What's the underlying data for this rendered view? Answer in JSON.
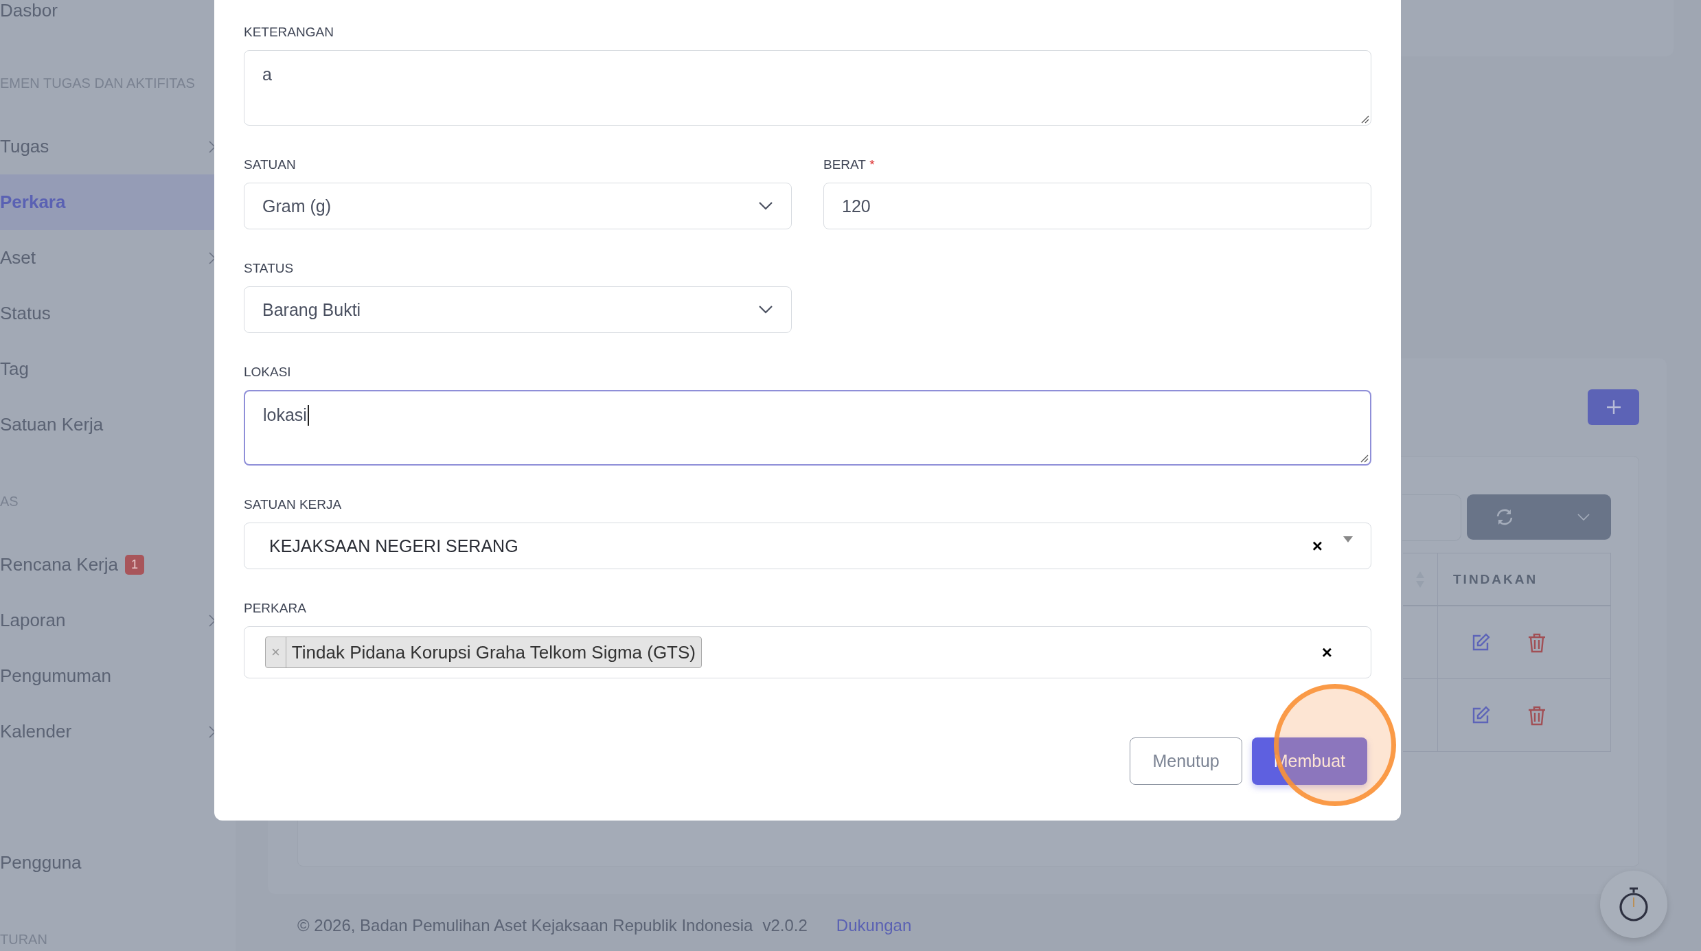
{
  "sidebar": {
    "sections": [
      {
        "items": [
          {
            "label": "Dasbor",
            "selected": false,
            "expandable": false
          }
        ]
      },
      {
        "heading": "EMEN TUGAS DAN AKTIFITAS",
        "items": [
          {
            "label": "Tugas",
            "selected": false,
            "expandable": true
          },
          {
            "label": "Perkara",
            "selected": true,
            "expandable": false
          },
          {
            "label": "Aset",
            "selected": false,
            "expandable": true
          },
          {
            "label": "Status",
            "selected": false,
            "expandable": false
          },
          {
            "label": "Tag",
            "selected": false,
            "expandable": false
          },
          {
            "label": "Satuan Kerja",
            "selected": false,
            "expandable": false
          }
        ]
      },
      {
        "heading": "AS",
        "items": [
          {
            "label": "Rencana Kerja",
            "selected": false,
            "expandable": false,
            "badge": "1"
          },
          {
            "label": "Laporan",
            "selected": false,
            "expandable": true
          },
          {
            "label": "Pengumuman",
            "selected": false,
            "expandable": false
          },
          {
            "label": "Kalender",
            "selected": false,
            "expandable": true
          }
        ]
      },
      {
        "items": [
          {
            "label": "Pengguna",
            "selected": false,
            "expandable": false
          }
        ]
      },
      {
        "heading": "TURAN"
      }
    ]
  },
  "table": {
    "columns": [
      "TINDAKAN"
    ],
    "rows": [
      {
        "kind": "actions"
      },
      {
        "kind": "actions"
      }
    ]
  },
  "footer": {
    "copyright": "© 2026, Badan Pemulihan Aset Kejaksaan Republik Indonesia",
    "version": "v2.0.2",
    "link": "Dukungan"
  },
  "modal": {
    "fields": [
      {
        "kind": "textarea",
        "label": "KETERANGAN",
        "value": "a",
        "focused": false
      },
      {
        "kind": "select",
        "label": "SATUAN",
        "value": "Gram (g)"
      },
      {
        "kind": "input",
        "label": "BERAT",
        "required_mark": "*",
        "value": "120"
      },
      {
        "kind": "select",
        "label": "STATUS",
        "value": "Barang Bukti"
      },
      {
        "kind": "textarea",
        "label": "LOKASI",
        "value": "lokasi",
        "focused": true
      },
      {
        "kind": "combo",
        "label": "SATUAN KERJA",
        "value": "KEJAKSAAN NEGERI SERANG",
        "clear": "×"
      },
      {
        "kind": "tags",
        "label": "PERKARA",
        "tags": [
          {
            "remove": "×",
            "label": "Tindak Pidana Korupsi Graha Telkom Sigma (GTS)"
          }
        ],
        "clear": "×"
      }
    ],
    "buttons": [
      {
        "kind": "secondary",
        "label": "Menutup"
      },
      {
        "kind": "primary",
        "label": "Membuat"
      }
    ]
  }
}
